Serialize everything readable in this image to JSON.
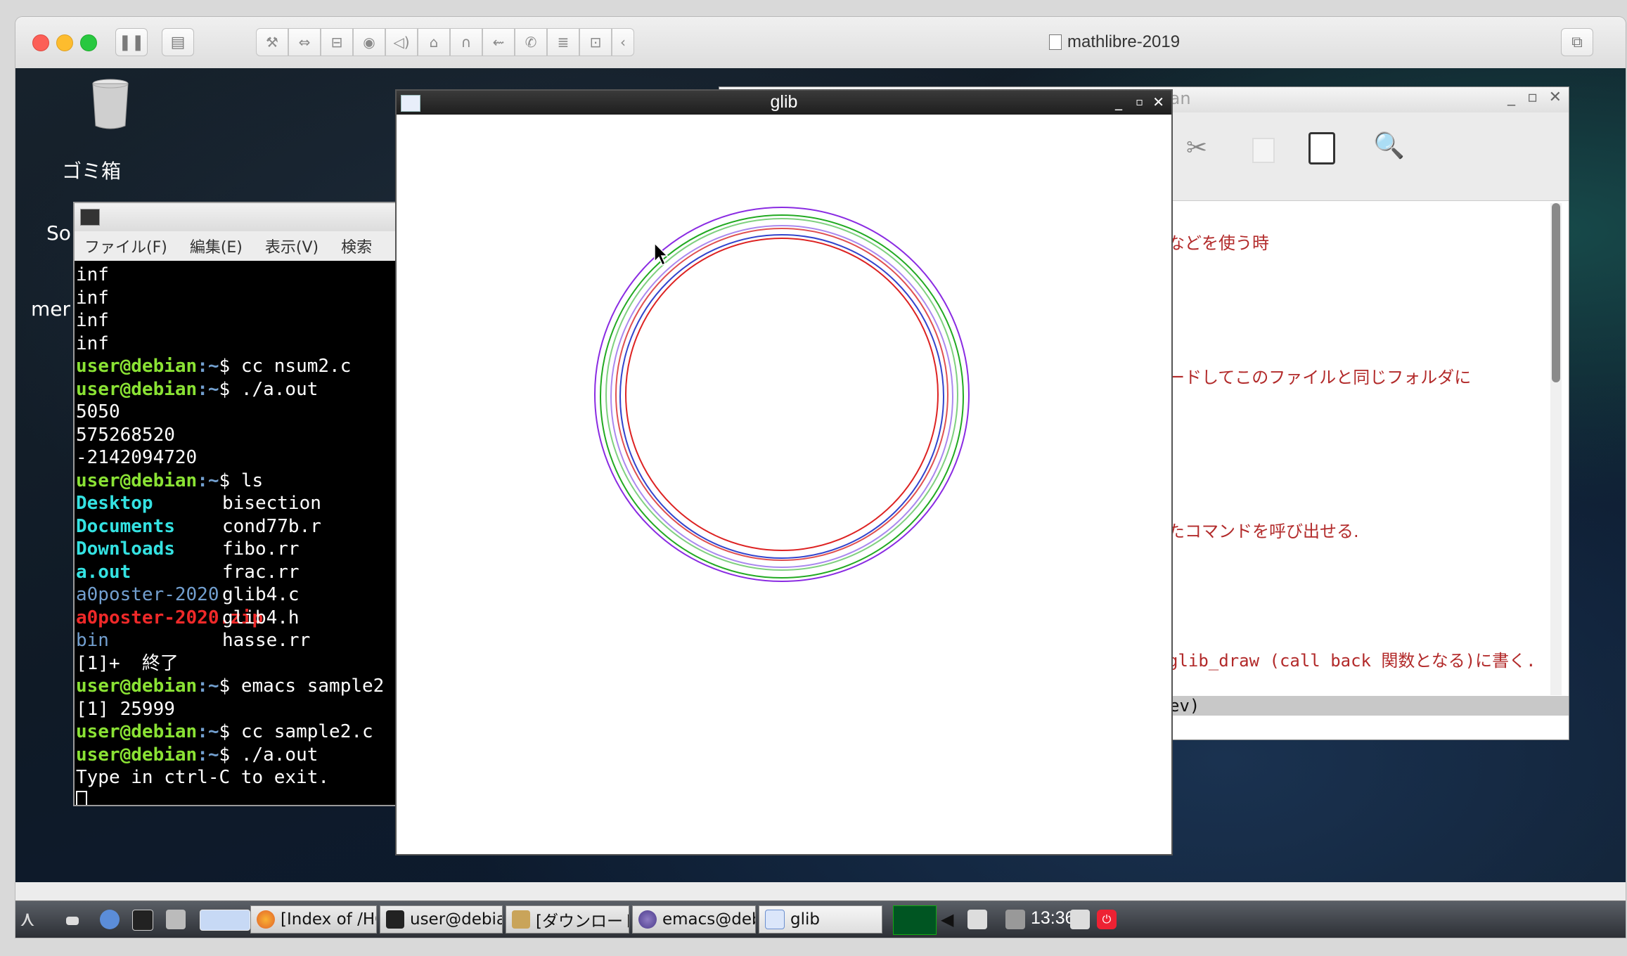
{
  "host": {
    "window_title": "mathlibre-2019"
  },
  "desktop": {
    "icons": [
      {
        "label": "ゴミ箱"
      },
      {
        "label": "So"
      },
      {
        "label": "mer"
      }
    ]
  },
  "terminal": {
    "menu": [
      "ファイル(F)",
      "編集(E)",
      "表示(V)",
      "検索"
    ],
    "prompt_user": "user@debian",
    "prompt_path": ":~",
    "prompt_symbol": "$",
    "lines": [
      {
        "type": "out",
        "text": "inf"
      },
      {
        "type": "out",
        "text": "inf"
      },
      {
        "type": "out",
        "text": "inf"
      },
      {
        "type": "out",
        "text": "inf"
      },
      {
        "type": "cmd",
        "text": "cc nsum2.c"
      },
      {
        "type": "cmd",
        "text": "./a.out"
      },
      {
        "type": "out",
        "text": "5050"
      },
      {
        "type": "out",
        "text": "575268520"
      },
      {
        "type": "out",
        "text": "-2142094720"
      },
      {
        "type": "cmd",
        "text": "ls"
      }
    ],
    "ls_rows": [
      {
        "left": "Desktop",
        "left_kind": "dir",
        "right": "bisection"
      },
      {
        "left": "Documents",
        "left_kind": "dir",
        "right": "cond77b.r"
      },
      {
        "left": "Downloads",
        "left_kind": "dir",
        "right": "fibo.rr"
      },
      {
        "left": "a.out",
        "left_kind": "dir",
        "right": "frac.rr"
      },
      {
        "left": "a0poster-2020",
        "left_kind": "link",
        "right": "glib4.c"
      },
      {
        "left": "a0poster-2020.zip",
        "left_kind": "zip",
        "right": "glib4.h"
      },
      {
        "left": "bin",
        "left_kind": "link",
        "right": "hasse.rr"
      }
    ],
    "tail": [
      {
        "type": "out",
        "text": "[1]+  終了"
      },
      {
        "type": "cmd",
        "text": "emacs sample2"
      },
      {
        "type": "out",
        "text": "[1] 25999"
      },
      {
        "type": "cmd",
        "text": "cc sample2.c"
      },
      {
        "type": "cmd",
        "text": "./a.out"
      },
      {
        "type": "out",
        "text": "Type in ctrl-C to exit."
      }
    ]
  },
  "emacs": {
    "title_fragment": "ian",
    "lines": [
      "などを使う時",
      "ードしてこのファイルと同じフォルダに",
      "たコマンドを呼び出せる.",
      "glib_draw (call back 関数となる)に書く."
    ],
    "modeline": "ev)"
  },
  "glib": {
    "title": "glib",
    "ring_colors": [
      "#8a2be2",
      "#22aa22",
      "#7fd07f",
      "#aa88ee",
      "#e05050",
      "#3344cc",
      "#dd2222"
    ]
  },
  "taskbar": {
    "tasks": [
      {
        "label": "[Index of /HOME/···",
        "icon": "firefox-icon"
      },
      {
        "label": "user@debian: ~",
        "icon": "terminal-icon"
      },
      {
        "label": "[ダウンロード]",
        "icon": "folder-icon"
      },
      {
        "label": "emacs@debian",
        "icon": "emacs-icon"
      },
      {
        "label": "glib",
        "icon": "window-icon"
      }
    ],
    "clock": "13:36"
  },
  "colors": {
    "terminal_user": "#8ae234",
    "terminal_dir": "#34e2e2",
    "terminal_zip": "#ef2929",
    "emacs_text": "#b22a2a"
  }
}
